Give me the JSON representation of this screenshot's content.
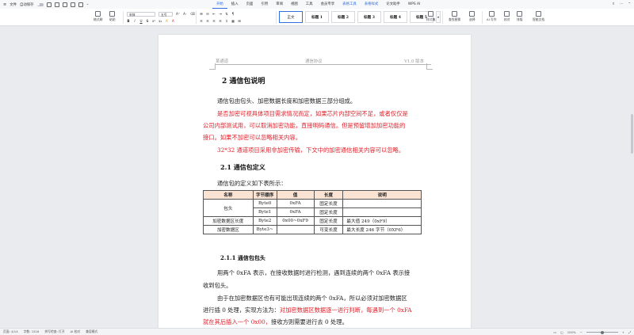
{
  "menubar": {
    "file_label": "文件",
    "autosave_label": "自动保存",
    "tabs": [
      {
        "label": "开始",
        "state": "active"
      },
      {
        "label": "插入"
      },
      {
        "label": "页面"
      },
      {
        "label": "引用"
      },
      {
        "label": "审阅"
      },
      {
        "label": "视图"
      },
      {
        "label": "工具"
      },
      {
        "label": "会员专享"
      },
      {
        "label": "表格工具",
        "state": "blue"
      },
      {
        "label": "表格样式",
        "state": "blue"
      },
      {
        "label": "论文助手"
      },
      {
        "label": "WPS AI"
      }
    ]
  },
  "ribbon": {
    "format_painter": "格式刷",
    "paste": "粘贴",
    "font_name": "宋体",
    "font_size": "五号",
    "bold": "B",
    "italic": "I",
    "underline": "U",
    "font_color_a": "A",
    "style_items": [
      "正文",
      "标题 1",
      "标题 2",
      "标题 3",
      "标题 4",
      "标题 5"
    ],
    "styles_set": "样式集",
    "find_replace": "查找替换",
    "select": "选择",
    "ai_writing": "AI 写作",
    "proofread": "校对",
    "typesetting": "排版",
    "smart_doc": "智能文档"
  },
  "document": {
    "header_left": "某通道",
    "header_center": "通信协议",
    "header_right": "V1.0 版本",
    "h1": "2 通信包说明",
    "p1": "通信包由包头、加密数据长度和加密数据三部分组成。",
    "p2_line1": "是否加密可视具体项目需求情况而定，如果芯片内部空间不足，或者仅仅是",
    "p2_line2": "公司内部测试用，可以取消加密功能，直接明码通信。但是预留增加加密功能的",
    "p2_line3": "接口。如果不加密可以忽略相关内容。",
    "p3": "32*32 通道项目采用非加密传输，下文中的加密通信相关内容可以忽略。",
    "h2_1": "2.1 通信包定义",
    "p4": "通信包的定义如下表所示：",
    "table": {
      "headers": [
        "名称",
        "字节顺序",
        "值",
        "长度",
        "说明"
      ],
      "rows": [
        {
          "name": "包头",
          "byte": "Byte0",
          "value": "0xFA",
          "length": "固定长度",
          "note": ""
        },
        {
          "name": "",
          "byte": "Byte1",
          "value": "0xFA",
          "length": "固定长度",
          "note": ""
        },
        {
          "name": "加密数据区长度",
          "byte": "Byte2",
          "value": "0x00~0xF9",
          "length": "固定长度",
          "note": "最大值 249（0xF9）"
        },
        {
          "name": "加密数据区",
          "byte": "Byte3~",
          "value": "",
          "length": "可变长度",
          "note": "最大长度 246 字节（0XF6）"
        }
      ]
    },
    "h3_1": "2.1.1 通信包包头",
    "p5_line1": "用两个 0xFA 表示，在接收数据时进行检测，遇到连续的两个 0xFA 表示接",
    "p5_line2": "收到包头。",
    "p6_line1": "由于在加密数据区也有可能出现连续的两个 0xFA，所以必须对加密数据区",
    "p6_line2_black": "进行插 0 处理，实现方法为：",
    "p6_line2_red": "对加密数据区数据逐一进行判断，每遇到一个 0xFA",
    "p6_line3_red": "就在其后插入一个 0x00，",
    "p6_line3_black": "接收方则需要进行去 0 处理。"
  },
  "statusbar": {
    "page": "页面: 4/14",
    "words": "字数: 1516",
    "spell": "拼写检查: 打开",
    "ai": "AI 校对",
    "compat": "兼容模式",
    "zoom": "100%"
  },
  "colors": {
    "accent": "#2f6fe4",
    "red_text": "#e0202a",
    "table_header": "#fbe3d4"
  }
}
